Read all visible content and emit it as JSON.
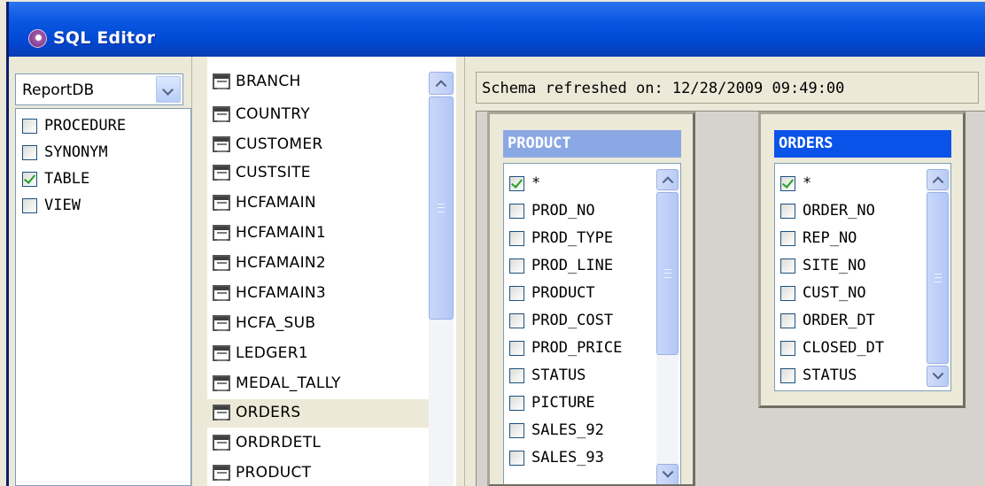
{
  "window": {
    "title": "SQL Editor"
  },
  "database_select": {
    "selected": "ReportDB"
  },
  "object_types": [
    {
      "label": "PROCEDURE",
      "checked": false
    },
    {
      "label": "SYNONYM",
      "checked": false
    },
    {
      "label": "TABLE",
      "checked": true
    },
    {
      "label": "VIEW",
      "checked": false
    }
  ],
  "tables": [
    "BRANCH",
    "COUNTRY",
    "CUSTOMER",
    "CUSTSITE",
    "HCFAMAIN",
    "HCFAMAIN1",
    "HCFAMAIN2",
    "HCFAMAIN3",
    "HCFA_SUB",
    "LEDGER1",
    "MEDAL_TALLY",
    "ORDERS",
    "ORDRDETL",
    "PRODUCT"
  ],
  "selected_table": "ORDERS",
  "status": {
    "text": "Schema refreshed on: 12/28/2009 09:49:00"
  },
  "entities": [
    {
      "name": "PRODUCT",
      "active": false,
      "header_color": "#8aa8e4",
      "columns": [
        {
          "label": "*",
          "checked": true
        },
        {
          "label": "PROD_NO",
          "checked": false
        },
        {
          "label": "PROD_TYPE",
          "checked": false
        },
        {
          "label": "PROD_LINE",
          "checked": false
        },
        {
          "label": "PRODUCT",
          "checked": false
        },
        {
          "label": "PROD_COST",
          "checked": false
        },
        {
          "label": "PROD_PRICE",
          "checked": false
        },
        {
          "label": "STATUS",
          "checked": false
        },
        {
          "label": "PICTURE",
          "checked": false
        },
        {
          "label": "SALES_92",
          "checked": false
        },
        {
          "label": "SALES_93",
          "checked": false
        }
      ]
    },
    {
      "name": "ORDERS",
      "active": true,
      "header_color": "#0a52e8",
      "columns": [
        {
          "label": "*",
          "checked": true
        },
        {
          "label": "ORDER_NO",
          "checked": false
        },
        {
          "label": "REP_NO",
          "checked": false
        },
        {
          "label": "SITE_NO",
          "checked": false
        },
        {
          "label": "CUST_NO",
          "checked": false
        },
        {
          "label": "ORDER_DT",
          "checked": false
        },
        {
          "label": "CLOSED_DT",
          "checked": false
        },
        {
          "label": "STATUS",
          "checked": false
        }
      ]
    }
  ]
}
